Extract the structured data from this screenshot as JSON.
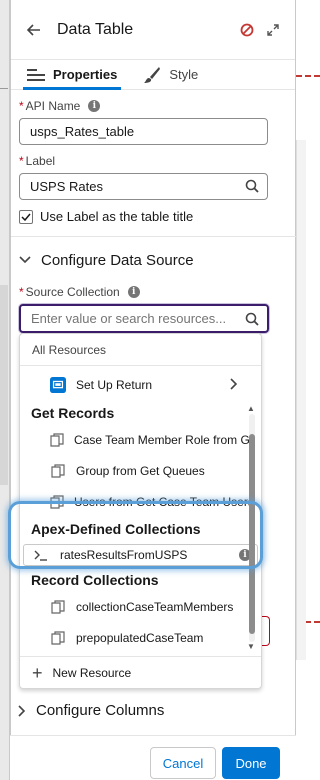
{
  "panel": {
    "title": "Data Table"
  },
  "tabs": [
    {
      "label": "Properties",
      "active": true
    },
    {
      "label": "Style",
      "active": false
    }
  ],
  "fields": {
    "api_name": {
      "label": "API Name",
      "value": "usps_Rates_table"
    },
    "label": {
      "label": "Label",
      "value": "USPS Rates"
    },
    "use_label_checkbox": {
      "label": "Use Label as the table title",
      "checked": true
    }
  },
  "data_source": {
    "section_title": "Configure Data Source",
    "source_collection_label": "Source Collection",
    "placeholder": "Enter value or search resources..."
  },
  "dropdown": {
    "all_resources": "All Resources",
    "setup_return": "Set Up Return",
    "groups": [
      {
        "title": "Get Records",
        "items": [
          "Case Team Member Role from G...",
          "Group from Get Queues",
          "Users from Get Case Team Users"
        ]
      },
      {
        "title": "Apex-Defined Collections",
        "items": [
          "ratesResultsFromUSPS"
        ]
      },
      {
        "title": "Record Collections",
        "items": [
          "collectionCaseTeamMembers",
          "prepopulatedCaseTeam"
        ]
      }
    ],
    "new_resource": "New Resource"
  },
  "columns_section": "Configure Columns",
  "footer": {
    "cancel": "Cancel",
    "done": "Done"
  },
  "colors": {
    "brand": "#0176d3",
    "callout": "#5a9fd8",
    "required": "#ba0517",
    "focus_border": "#3b1d6b"
  }
}
